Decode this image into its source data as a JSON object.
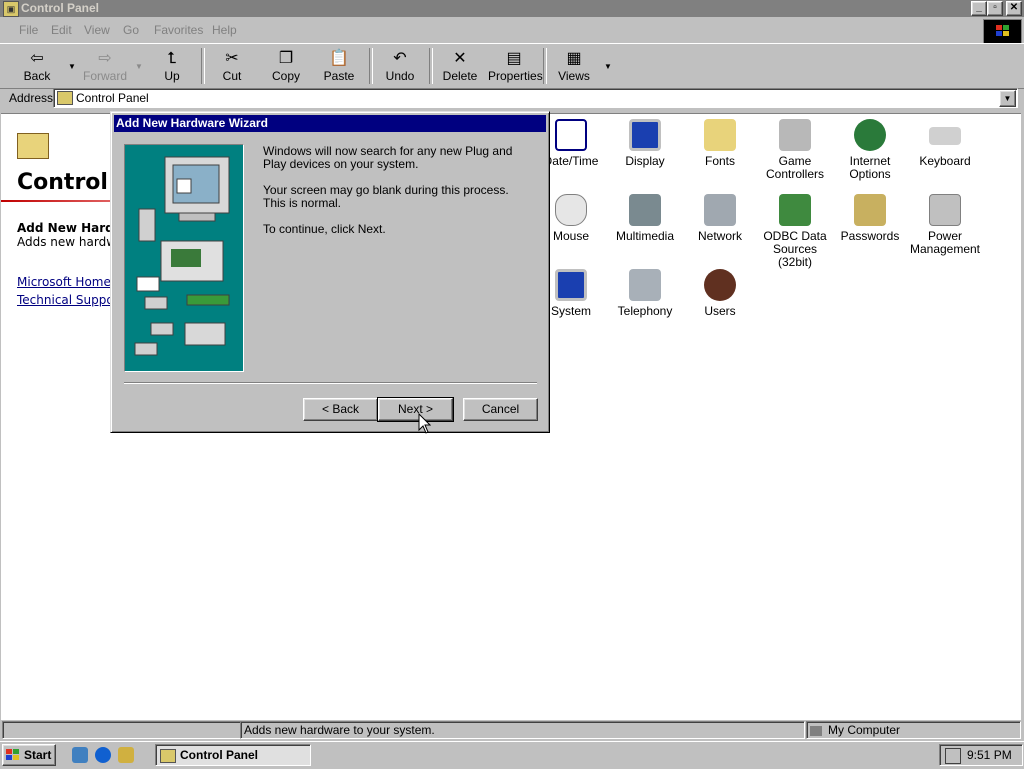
{
  "window": {
    "title": "Control Panel",
    "controls": [
      "_",
      "▫",
      "✕"
    ]
  },
  "menu": [
    "File",
    "Edit",
    "View",
    "Go",
    "Favorites",
    "Help"
  ],
  "toolbar": {
    "back": "Back",
    "forward": "Forward",
    "up": "Up",
    "cut": "Cut",
    "copy": "Copy",
    "paste": "Paste",
    "undo": "Undo",
    "delete": "Delete",
    "properties": "Properties",
    "views": "Views"
  },
  "address": {
    "label": "Address",
    "value": "Control Panel"
  },
  "left_pane": {
    "heading": "Control",
    "selected_title": "Add New Hardw",
    "selected_desc": "Adds new hardw",
    "links": [
      "Microsoft Home",
      "Technical Suppo"
    ]
  },
  "icons": [
    {
      "label": "Date/Time",
      "icon": "calendar-clock-icon"
    },
    {
      "label": "Display",
      "icon": "monitor-icon"
    },
    {
      "label": "Fonts",
      "icon": "fonts-folder-icon"
    },
    {
      "label": "Game Controllers",
      "icon": "joystick-icon"
    },
    {
      "label": "Internet Options",
      "icon": "globe-icon"
    },
    {
      "label": "Keyboard",
      "icon": "keyboard-icon"
    },
    {
      "label": "Mouse",
      "icon": "mouse-icon"
    },
    {
      "label": "Multimedia",
      "icon": "multimedia-icon"
    },
    {
      "label": "Network",
      "icon": "network-icon"
    },
    {
      "label": "ODBC Data Sources (32bit)",
      "icon": "odbc-icon"
    },
    {
      "label": "Passwords",
      "icon": "keys-icon"
    },
    {
      "label": "Power Management",
      "icon": "power-icon"
    },
    {
      "label": "System",
      "icon": "computer-icon"
    },
    {
      "label": "Telephony",
      "icon": "telephone-icon"
    },
    {
      "label": "Users",
      "icon": "users-icon"
    }
  ],
  "dialog": {
    "title": "Add New Hardware Wizard",
    "paragraphs": [
      "Windows will now search for any new Plug and Play devices on your system.",
      "Your screen may go blank during this process. This is normal.",
      "To continue, click Next."
    ],
    "back": "< Back",
    "next": "Next >",
    "cancel": "Cancel"
  },
  "status": {
    "text": "Adds new hardware to your system.",
    "zone": "My Computer"
  },
  "taskbar": {
    "start": "Start",
    "app": "Control Panel",
    "clock": "9:51 PM"
  }
}
